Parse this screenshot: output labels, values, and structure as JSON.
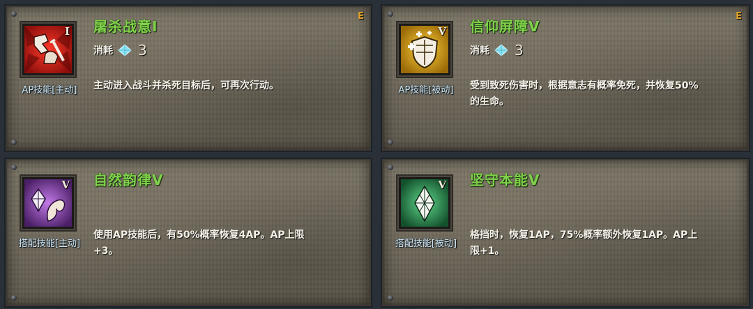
{
  "cards": [
    {
      "name": "屠杀战意I",
      "roman": "I",
      "grade": "E",
      "type": "AP技能[主动]",
      "cost_label": "消耗",
      "cost_value": "3",
      "description": "主动进入战斗并杀死目标后，可再次行动。",
      "icon": "slaughter-skill-icon",
      "icon_color": "#c0201c"
    },
    {
      "name": "信仰屏障V",
      "roman": "V",
      "grade": "E",
      "type": "AP技能[被动]",
      "cost_label": "消耗",
      "cost_value": "3",
      "description": "受到致死伤害时，根据意志有概率免死，并恢复50%的生命。",
      "icon": "faith-shield-icon",
      "icon_color": "#d9a31a"
    },
    {
      "name": "自然韵律V",
      "roman": "V",
      "type": "搭配技能[主动]",
      "description": "使用AP技能后，有50%概率恢复4AP。AP上限+3。",
      "icon": "natural-rhythm-icon",
      "icon_color": "#7a3f9e"
    },
    {
      "name": "坚守本能V",
      "roman": "V",
      "type": "搭配技能[被动]",
      "description": "格挡时，恢复1AP，75%概率额外恢复1AP。AP上限+1。",
      "icon": "steadfast-instinct-icon",
      "icon_color": "#2f9a55"
    }
  ],
  "colors": {
    "title_green": "#7fd24a",
    "grade_orange": "#e0a22a",
    "type_blue": "#cfe3f0",
    "card_bg": "#6d675a"
  }
}
